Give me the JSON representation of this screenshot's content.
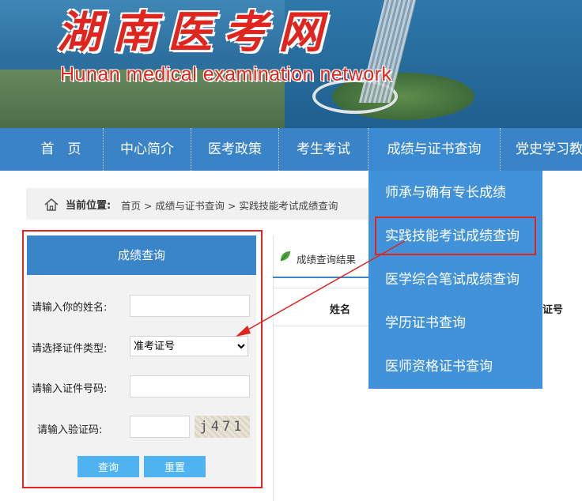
{
  "banner": {
    "title_cn": "湖南医考网",
    "title_en": "Hunan medical examination network"
  },
  "nav": {
    "items": [
      {
        "label": "首　页"
      },
      {
        "label": "中心简介"
      },
      {
        "label": "医考政策"
      },
      {
        "label": "考生考试"
      },
      {
        "label": "成绩与证书查询"
      },
      {
        "label": "党史学习教"
      }
    ],
    "active_index": 4
  },
  "dropdown": {
    "items": [
      {
        "label": "师承与确有专长成绩"
      },
      {
        "label": "实践技能考试成绩查询"
      },
      {
        "label": "医学综合笔试成绩查询"
      },
      {
        "label": "学历证书查询"
      },
      {
        "label": "医师资格证书查询"
      }
    ],
    "highlighted_index": 1
  },
  "breadcrumb": {
    "label": "当前位置:",
    "path": "首页 > 成绩与证书查询 > 实践技能考试成绩查询"
  },
  "query_panel": {
    "title": "成绩查询",
    "name_label": "请输入你的姓名:",
    "name_value": "",
    "id_type_label": "请选择证件类型:",
    "id_type_selected": "准考证号",
    "id_number_label": "请输入证件号码:",
    "id_number_value": "",
    "captcha_label": "请输入验证码:",
    "captcha_value": "",
    "captcha_image_text": "j471",
    "submit_label": "查询",
    "reset_label": "重置"
  },
  "results": {
    "tab_label": "成绩查询结果",
    "columns": [
      "姓名",
      "证号"
    ]
  },
  "colors": {
    "nav_blue": "#3a83c6",
    "dropdown_blue": "#4192d8",
    "highlight_red": "#e0241e",
    "button_blue": "#4fb3f1"
  }
}
